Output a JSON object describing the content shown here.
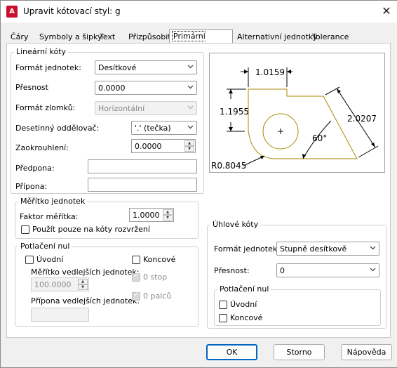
{
  "window": {
    "title": "Upravit kótovací styl: g",
    "app_icon_letter": "A"
  },
  "tabs": [
    {
      "label": "Čáry"
    },
    {
      "label": "Symboly a šipky"
    },
    {
      "label": "Text"
    },
    {
      "label": "Přizpůsobit"
    },
    {
      "label": "Primární jednotky",
      "active": true
    },
    {
      "label": "Alternativní jednotky"
    },
    {
      "label": "Tolerance"
    }
  ],
  "linear": {
    "legend": "Lineární kóty",
    "unit_format_label": "Formát jednotek:",
    "unit_format_value": "Desítkové",
    "precision_label": "Přesnost",
    "precision_value": "0.0000",
    "fraction_format_label": "Formát zlomků:",
    "fraction_format_value": "Horizontální",
    "decimal_sep_label": "Desetinný oddělovač:",
    "decimal_sep_value": "'.' (tečka)",
    "round_off_label": "Zaokrouhlení:",
    "round_off_value": "0.0000",
    "prefix_label": "Předpona:",
    "prefix_value": "",
    "suffix_label": "Přípona:",
    "suffix_value": ""
  },
  "scale": {
    "legend": "Měřítko jednotek",
    "factor_label": "Faktor měřítka:",
    "factor_value": "1.0000",
    "layout_only_label": "Použít pouze na kóty rozvržení"
  },
  "zero_suppress": {
    "legend": "Potlačení nul",
    "leading_label": "Úvodní",
    "trailing_label": "Koncové",
    "sub_unit_factor_label": "Měřítko vedlejších jednotek:",
    "sub_unit_factor_value": "100.0000",
    "zero_feet_label": "0 stop",
    "zero_inches_label": "0 palců",
    "sub_unit_suffix_label": "Přípona vedlejších jednotek:"
  },
  "preview": {
    "dim_top": "1.0159",
    "dim_left": "1.1955",
    "dim_right": "2.0207",
    "angle": "60°",
    "radius": "R0.8045"
  },
  "angular": {
    "legend": "Úhlové kóty",
    "unit_format_label": "Formát jednotek:",
    "unit_format_value": "Stupně desítkově",
    "precision_label": "Přesnost:",
    "precision_value": "0",
    "zero_legend": "Potlačení nul",
    "leading_label": "Úvodní",
    "trailing_label": "Koncové"
  },
  "buttons": {
    "ok": "OK",
    "cancel": "Storno",
    "help": "Nápověda"
  }
}
